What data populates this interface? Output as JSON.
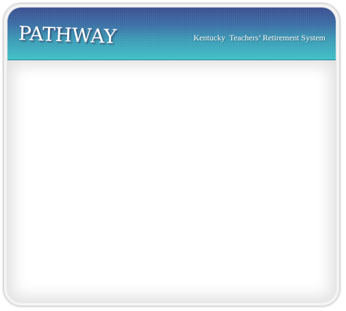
{
  "header": {
    "logo_text": "PATHWAY",
    "org_name": "Kentucky  Teachers’ Retirement System"
  },
  "colors": {
    "header_top": "#3a4e8f",
    "header_bottom": "#3fc1c6",
    "content_bg": "#ffffff"
  }
}
